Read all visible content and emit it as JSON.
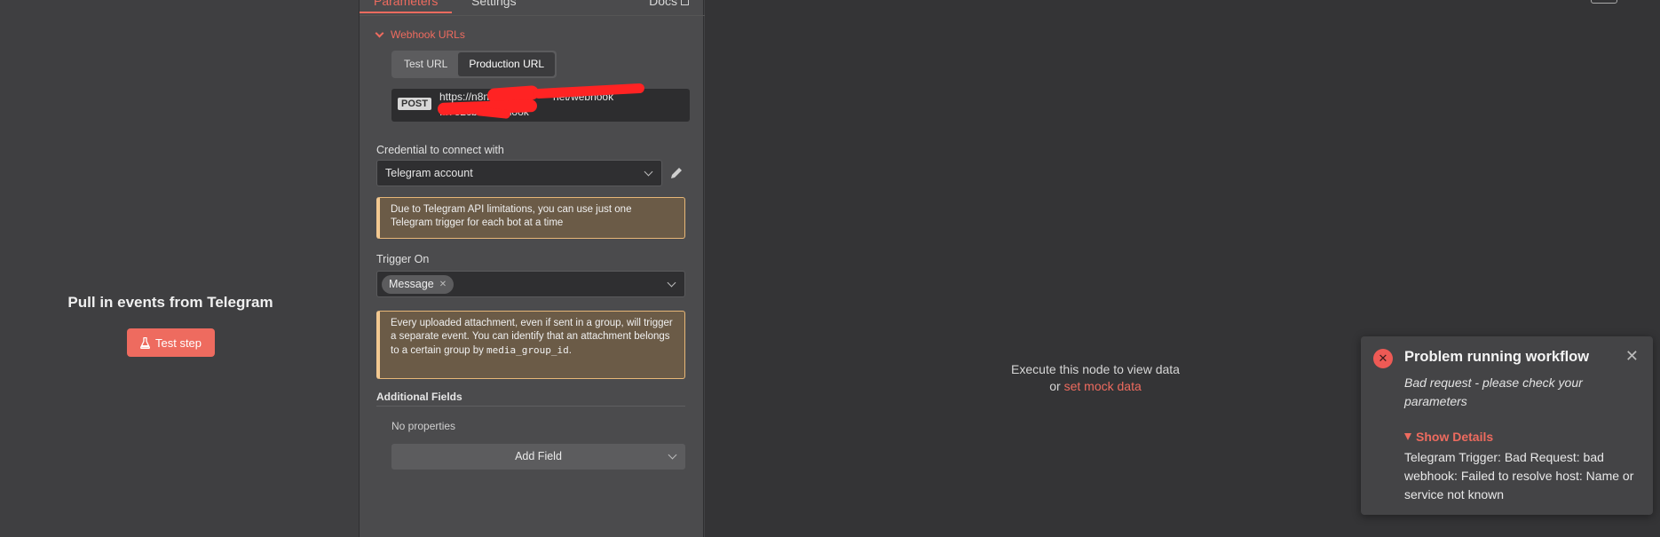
{
  "input_panel": {
    "title": "Pull in events from Telegram",
    "test_step_label": "Test step"
  },
  "params_panel": {
    "tabs": {
      "parameters": "Parameters",
      "settings": "Settings",
      "docs": "Docs"
    },
    "webhook_section": "Webhook URLs",
    "url_toggle": {
      "test": "Test URL",
      "production": "Production URL",
      "selected": "Production URL"
    },
    "url": {
      "method": "POST",
      "line1": "https://n8n",
      "line1b": "net/webhook",
      "line2": "...7e2cb2/webhook"
    },
    "credential": {
      "label": "Credential to connect with",
      "value": "Telegram account"
    },
    "notice1": "Due to Telegram API limitations, you can use just one Telegram trigger for each bot at a time",
    "trigger_on": {
      "label": "Trigger On",
      "chip": "Message"
    },
    "notice2": {
      "text": "Every uploaded attachment, even if sent in a group, will trigger a separate event. You can identify that an attachment belongs to a certain group by",
      "code": "media_group_id",
      "suffix": "."
    },
    "additional_fields": {
      "title": "Additional Fields",
      "empty": "No properties",
      "add_button": "Add Field"
    }
  },
  "output_panel": {
    "line1": "Execute this node to view data",
    "line2_prefix": "or",
    "mock_link": "set mock data"
  },
  "toast": {
    "title": "Problem running workflow",
    "subtitle": "Bad request - please check your parameters",
    "details_toggle": "Show Details",
    "details": "Telegram Trigger: Bad Request: bad webhook: Failed to resolve host: Name or service not known"
  },
  "colors": {
    "accent": "#ee6b5f",
    "warning_border": "#e7b778",
    "redaction": "#ff2323"
  }
}
